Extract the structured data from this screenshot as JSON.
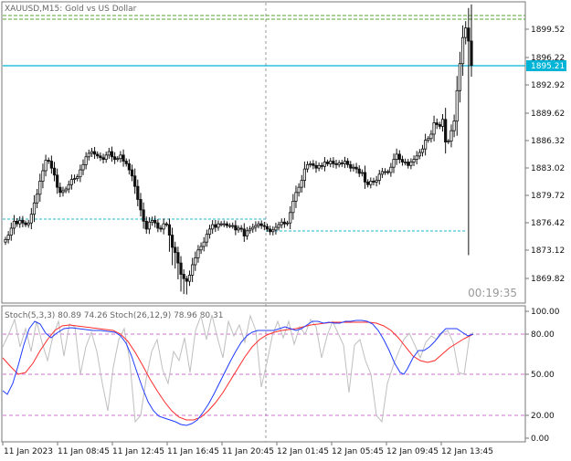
{
  "header": {
    "symbol_line": "XAUUSD,M15: Gold vs US Dollar"
  },
  "countdown": "00:19:35",
  "colors": {
    "bull": "#111111",
    "bear": "#111111",
    "bid_line": "#00b4d8",
    "price_tag_bg": "#00b4d8",
    "level_line": "#55a630",
    "dotted_level": "#1fb8cc",
    "stoch_main": "#1f3cff",
    "stoch_signal": "#ff2a2a",
    "stoch_fast": "#bfbfbf",
    "stoch_levels": "#d070d0",
    "grid_crosshair": "#999999"
  },
  "price_axis": {
    "labels": [
      "1899.52",
      "1896.22",
      "1892.92",
      "1889.62",
      "1886.32",
      "1883.02",
      "1879.72",
      "1876.42",
      "1873.12",
      "1869.82"
    ],
    "current_price": "1895.21"
  },
  "time_axis": {
    "labels": [
      "11 Jan 2023",
      "11 Jan 08:45",
      "11 Jan 12:45",
      "11 Jan 16:45",
      "11 Jan 20:45",
      "12 Jan 01:45",
      "12 Jan 05:45",
      "12 Jan 09:45",
      "12 Jan 13:45"
    ]
  },
  "indicator": {
    "title": "Stoch(5,3,3) 80.89 74.26 Stoch(26,12,9) 78.96 80.31",
    "axis_labels": [
      "100.00",
      "80.00",
      "50.00",
      "20.00",
      "0.00"
    ],
    "levels": [
      80,
      50,
      20
    ]
  },
  "chart_data": {
    "type": "candlestick",
    "symbol": "XAUUSD",
    "timeframe": "M15",
    "ylim": [
      1868.0,
      1902.4
    ],
    "closes": [
      1875.2,
      1875.7,
      1876.5,
      1877.3,
      1877.0,
      1877.4,
      1877.1,
      1876.9,
      1877.1,
      1878.1,
      1879.4,
      1880.4,
      1881.9,
      1883.1,
      1884.3,
      1884.2,
      1883.4,
      1882.6,
      1881.2,
      1880.6,
      1880.8,
      1881.0,
      1881.5,
      1882.1,
      1882.2,
      1882.4,
      1883.2,
      1883.8,
      1884.7,
      1885.1,
      1885.3,
      1885.0,
      1884.8,
      1884.6,
      1884.4,
      1884.9,
      1885.3,
      1884.7,
      1884.4,
      1884.5,
      1884.9,
      1884.2,
      1883.9,
      1883.2,
      1882.5,
      1881.3,
      1879.8,
      1878.6,
      1877.3,
      1876.4,
      1877.2,
      1877.4,
      1877.1,
      1876.5,
      1876.4,
      1877.0,
      1876.9,
      1875.7,
      1874.3,
      1873.7,
      1872.5,
      1871.2,
      1870.7,
      1870.4,
      1871.1,
      1872.3,
      1873.1,
      1874.0,
      1874.4,
      1874.9,
      1875.8,
      1876.4,
      1876.9,
      1876.6,
      1877.0,
      1877.0,
      1877.0,
      1876.8,
      1876.8,
      1876.8,
      1876.3,
      1876.5,
      1876.4,
      1875.6,
      1876.2,
      1876.4,
      1876.6,
      1876.8,
      1877.0,
      1876.8,
      1876.7,
      1876.4,
      1876.1,
      1876.3,
      1876.6,
      1876.9,
      1877.2,
      1877.0,
      1877.1,
      1878.3,
      1879.6,
      1880.6,
      1881.2,
      1882.0,
      1883.3,
      1883.8,
      1883.9,
      1883.7,
      1883.4,
      1883.7,
      1883.6,
      1884.1,
      1883.9,
      1884.2,
      1883.9,
      1883.8,
      1884.0,
      1883.9,
      1884.2,
      1883.8,
      1883.4,
      1883.5,
      1883.3,
      1882.8,
      1882.9,
      1881.8,
      1881.5,
      1881.9,
      1881.8,
      1882.0,
      1882.7,
      1883.0,
      1883.0,
      1882.9,
      1883.5,
      1884.4,
      1885.0,
      1884.4,
      1884.1,
      1884.1,
      1883.7,
      1884.1,
      1884.4,
      1884.8,
      1885.2,
      1885.6,
      1886.6,
      1886.8,
      1887.3,
      1888.6,
      1888.4,
      1888.2,
      1889.0,
      1886.4,
      1886.5,
      1887.7,
      1888.8,
      1892.3,
      1895.4,
      1898.4,
      1899.5,
      1898.0,
      1895.2
    ]
  }
}
